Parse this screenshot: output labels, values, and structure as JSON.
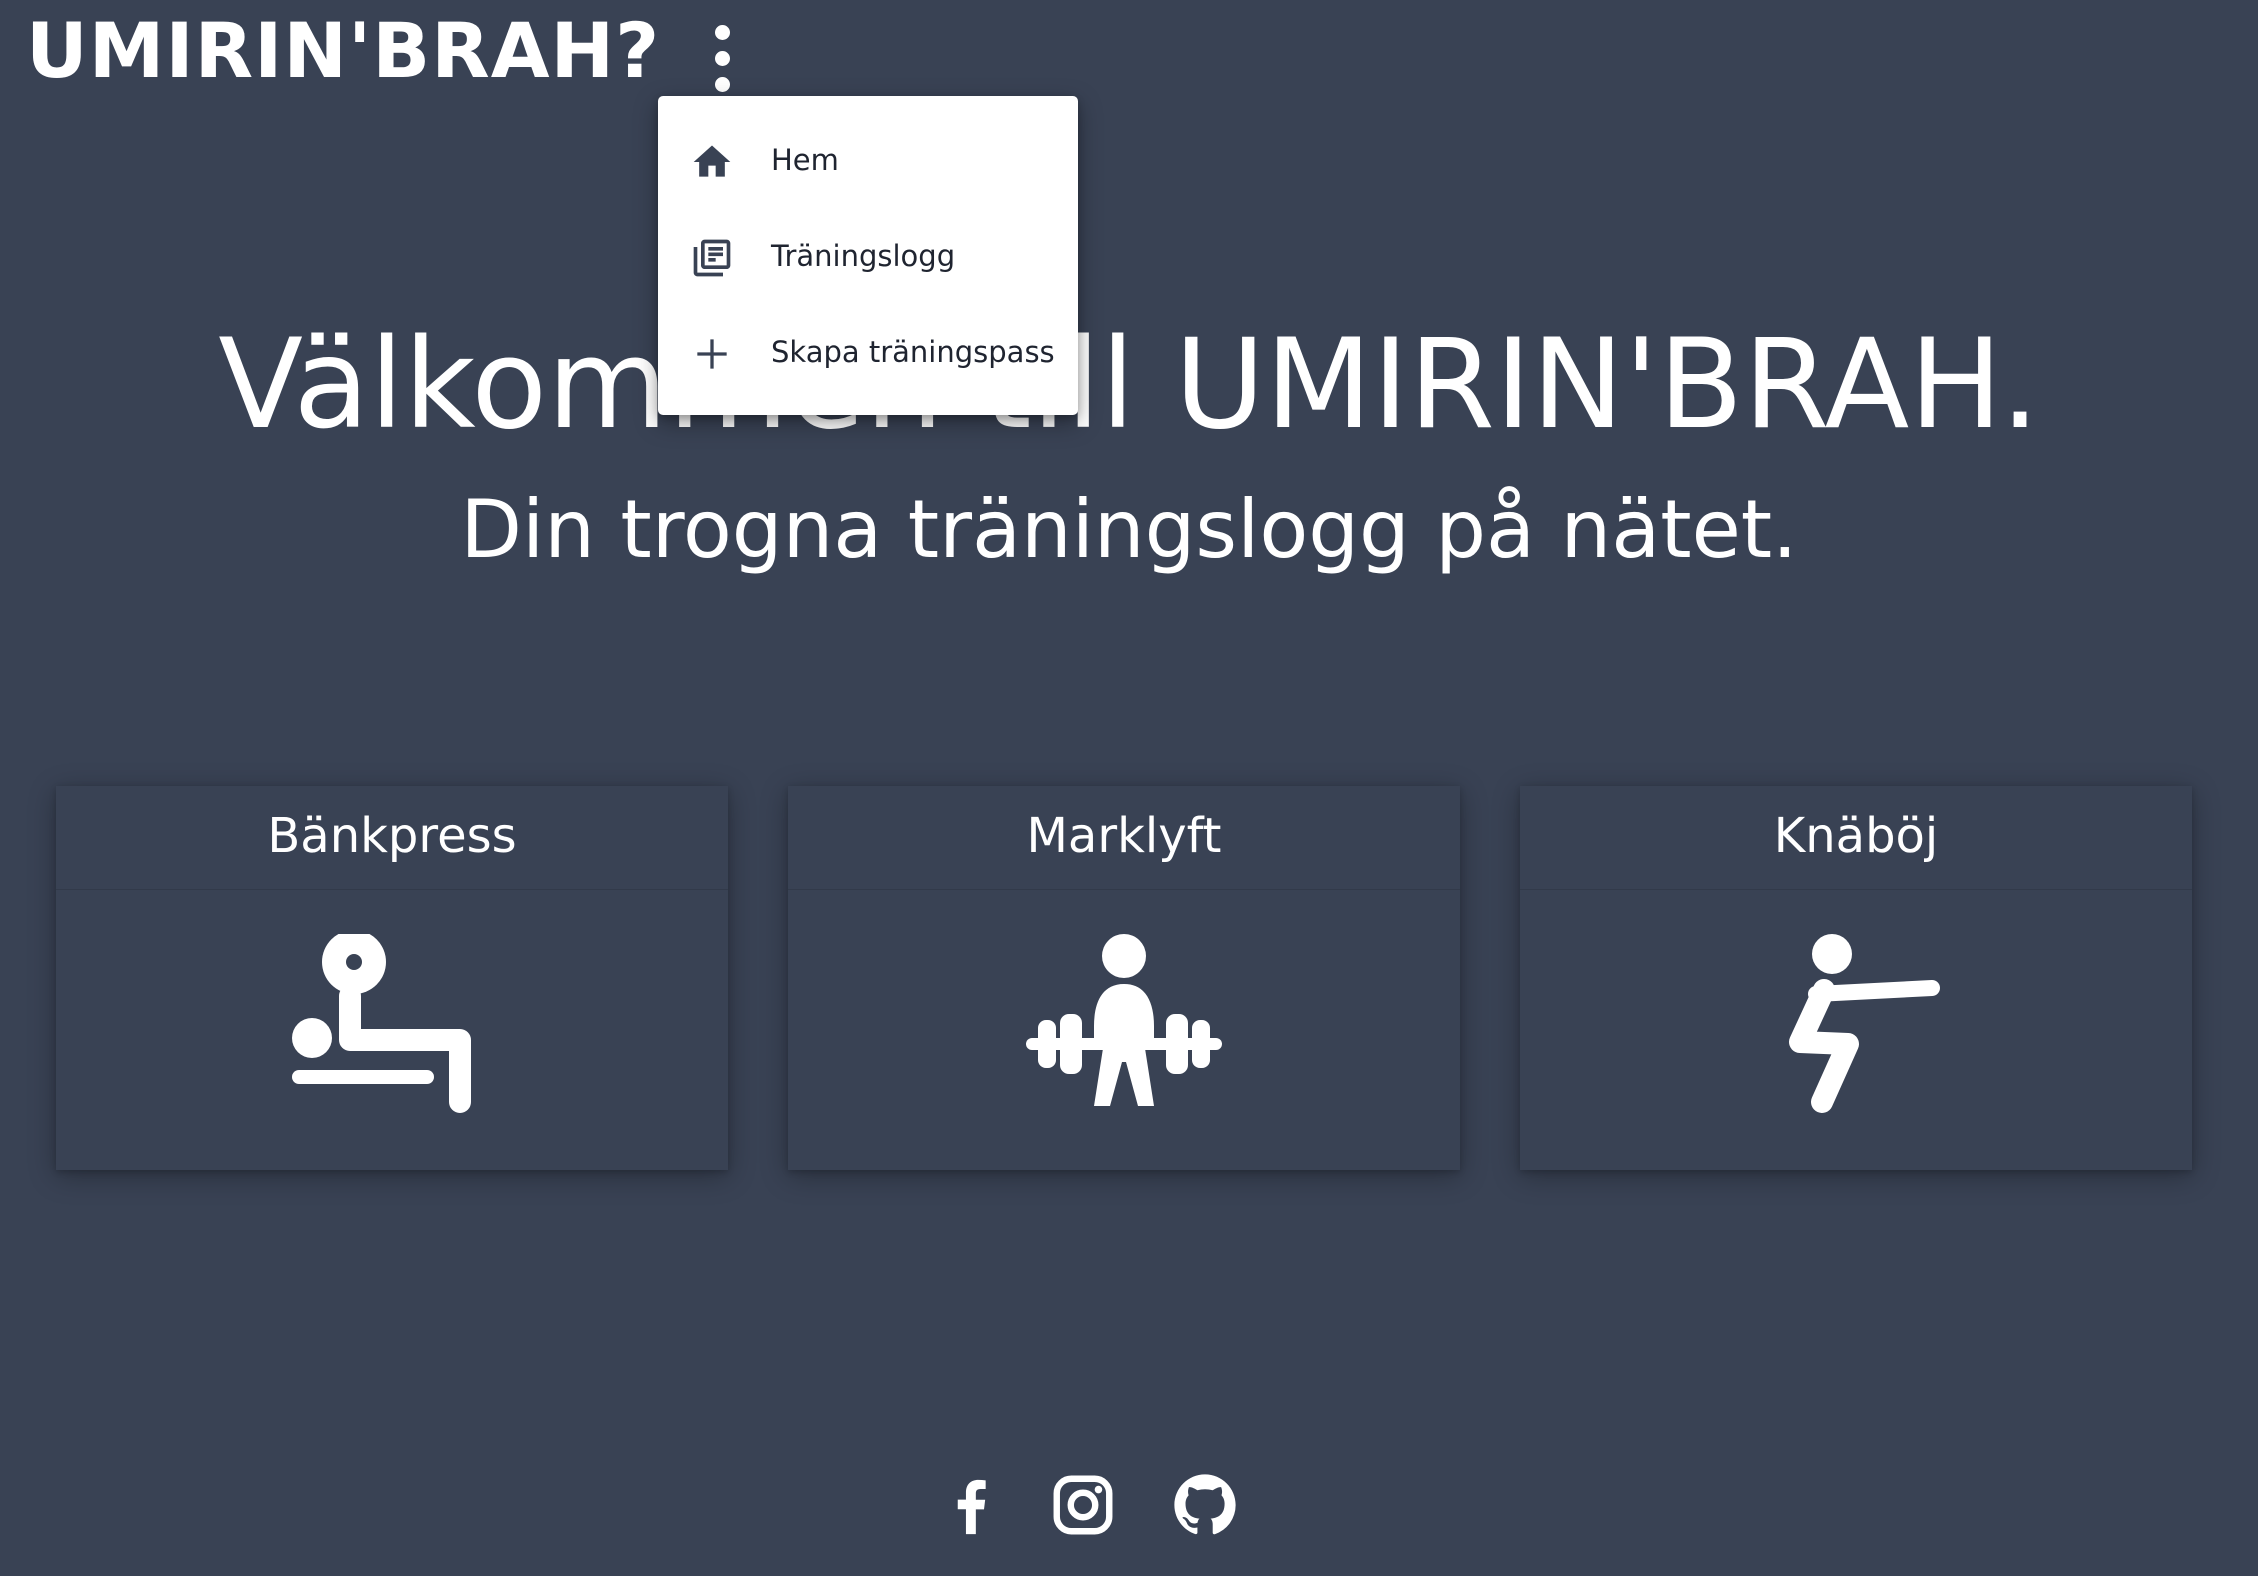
{
  "header": {
    "logo": "UMIRIN'BRAH?",
    "menu_icon": "more-vert-icon"
  },
  "menu": {
    "items": [
      {
        "label": "Hem",
        "icon": "home-icon"
      },
      {
        "label": "Träningslogg",
        "icon": "library-books-icon"
      },
      {
        "label": "Skapa träningspass",
        "icon": "plus-icon"
      }
    ]
  },
  "hero": {
    "title": "Välkommen till UMIRIN'BRAH.",
    "subtitle": "Din trogna träningslogg på nätet."
  },
  "cards": [
    {
      "title": "Bänkpress",
      "icon": "bench-press-icon"
    },
    {
      "title": "Marklyft",
      "icon": "deadlift-icon"
    },
    {
      "title": "Knäböj",
      "icon": "squat-icon"
    }
  ],
  "footer": {
    "social": [
      {
        "name": "Facebook",
        "icon": "facebook-icon"
      },
      {
        "name": "Instagram",
        "icon": "instagram-icon"
      },
      {
        "name": "GitHub",
        "icon": "github-icon"
      }
    ]
  },
  "colors": {
    "background": "#394254",
    "text": "#ffffff",
    "menu_background": "#ffffff",
    "menu_text": "#1f2430",
    "menu_icon": "#394254"
  }
}
